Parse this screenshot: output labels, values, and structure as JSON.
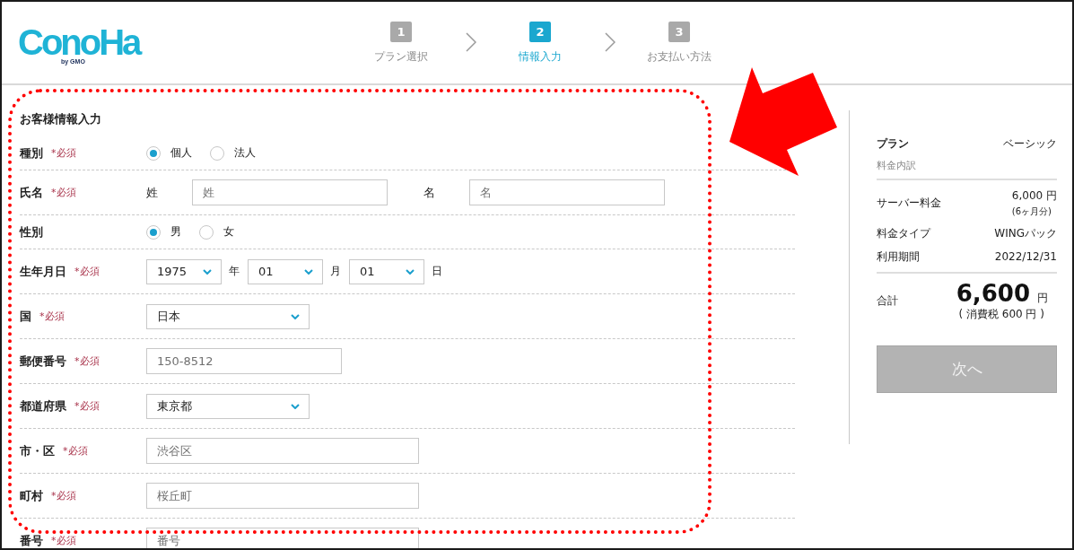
{
  "header": {
    "logo": "ConoHa",
    "logo_sub": "by GMO",
    "steps": [
      {
        "number": "1",
        "label": "プラン選択",
        "selected": false
      },
      {
        "number": "2",
        "label": "情報入力",
        "selected": true
      },
      {
        "number": "3",
        "label": "お支払い方法",
        "selected": false
      }
    ]
  },
  "form": {
    "title": "お客様情報入力",
    "rows": [
      {
        "kind": "radio",
        "label": "種別",
        "required": "*必須",
        "options": [
          {
            "label": "個人",
            "selected": true
          },
          {
            "label": "法人",
            "selected": false
          }
        ]
      },
      {
        "kind": "name",
        "label": "氏名",
        "required": "*必須",
        "fields": [
          {
            "caption": "姓",
            "placeholder": "姓"
          },
          {
            "caption": "名",
            "placeholder": "名"
          }
        ]
      },
      {
        "kind": "radio",
        "label": "性別",
        "options": [
          {
            "label": "男",
            "selected": true
          },
          {
            "label": "女",
            "selected": false
          }
        ]
      },
      {
        "kind": "date",
        "label": "生年月日",
        "required": "*必須",
        "selects": [
          {
            "value": "1975",
            "unit": "年"
          },
          {
            "value": "01",
            "unit": "月"
          },
          {
            "value": "01",
            "unit": "日"
          }
        ]
      },
      {
        "kind": "select",
        "label": "国",
        "required": "*必須",
        "value": "日本"
      },
      {
        "kind": "postal",
        "label": "郵便番号",
        "required": "*必須",
        "placeholder": "150-8512"
      },
      {
        "kind": "select",
        "label": "都道府県",
        "required": "*必須",
        "value": "東京都"
      },
      {
        "kind": "text",
        "label": "市・区",
        "required": "*必須",
        "placeholder": "渋谷区"
      },
      {
        "kind": "text",
        "label": "町村",
        "required": "*必須",
        "placeholder": "桜丘町"
      },
      {
        "kind": "text",
        "label": "番号",
        "required": "*必須",
        "placeholder": "番号"
      }
    ]
  },
  "summary": {
    "plan_label": "プラン",
    "plan_value": "ベーシック",
    "breakdown_label": "料金内訳",
    "items": [
      {
        "label": "サーバー料金",
        "value": "6,000 円",
        "note": "(6ヶ月分)"
      },
      {
        "label": "料金タイプ",
        "value": "WINGパック"
      },
      {
        "label": "利用期間",
        "value": "2022/12/31"
      }
    ],
    "total": {
      "label": "合計",
      "amount": "6,600",
      "unit": "円",
      "tax": "( 消費税 600 円 )"
    },
    "button": {
      "label": "次へ",
      "disabled": true
    }
  }
}
